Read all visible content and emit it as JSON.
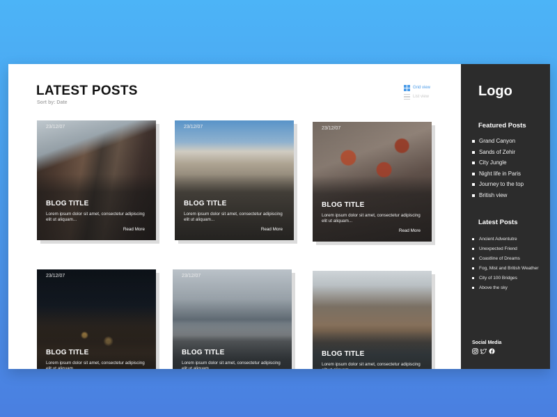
{
  "main": {
    "title": "LATEST POSTS",
    "sort_label": "Sort by: Date",
    "view_toggle": {
      "grid_label": "Grid view",
      "list_label": "List view"
    },
    "posts": [
      {
        "date": "23/12/07",
        "title": "BLOG TITLE",
        "excerpt": "Lorem ipsum dolor sit amet, consectetur adipiscing elit ut aliquam...",
        "read_more": "Read More"
      },
      {
        "date": "23/12/07",
        "title": "BLOG TITLE",
        "excerpt": "Lorem ipsum dolor sit amet, consectetur adipiscing elit ut aliquam...",
        "read_more": "Read More"
      },
      {
        "date": "23/12/07",
        "title": "BLOG TITLE",
        "excerpt": "Lorem ipsum dolor sit amet, consectetur adipiscing elit ut aliquam...",
        "read_more": "Read More"
      },
      {
        "date": "23/12/07",
        "title": "BLOG TITLE",
        "excerpt": "Lorem ipsum dolor sit amet, consectetur adipiscing elit ut aliquam...",
        "read_more": ""
      },
      {
        "date": "23/12/07",
        "title": "BLOG TITLE",
        "excerpt": "Lorem ipsum dolor sit amet, consectetur adipiscing elit ut aliquam...",
        "read_more": ""
      },
      {
        "date": "",
        "title": "BLOG TITLE",
        "excerpt": "Lorem ipsum dolor sit amet, consectetur adipiscing elit ut aliquam...",
        "read_more": ""
      }
    ]
  },
  "sidebar": {
    "logo": "Logo",
    "featured_heading": "Featured Posts",
    "featured": [
      "Grand Canyon",
      "Sands of Zehir",
      "City Jungle",
      "Night life in Paris",
      "Journey to the top",
      "British view"
    ],
    "latest_heading": "Latest Posts",
    "latest": [
      "Ancient Adventutre",
      "Unexpected Friend",
      "Coastline of Dreams",
      "Fog, Mist and British Weather",
      "City of 100 Bridges",
      "Above the sky"
    ],
    "social_label": "Social Media",
    "social_icons": [
      "instagram-icon",
      "twitter-icon",
      "facebook-icon"
    ]
  },
  "colors": {
    "accent": "#4a9be8",
    "sidebar_bg": "#2c2c2c"
  }
}
